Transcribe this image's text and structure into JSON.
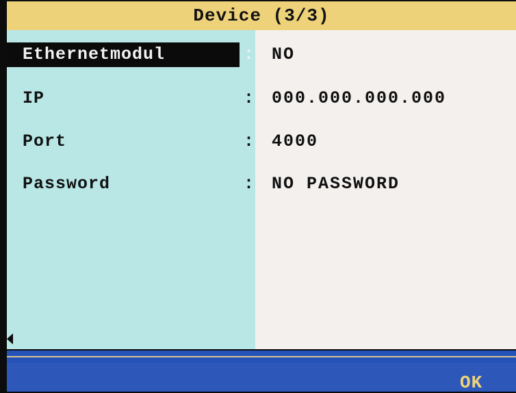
{
  "window": {
    "title": "Device (3/3)"
  },
  "settings": [
    {
      "label": "Ethernetmodul",
      "colon": ":",
      "value": "NO",
      "selected": true
    },
    {
      "label": "IP",
      "colon": ":",
      "value": "000.000.000.000",
      "selected": false
    },
    {
      "label": "Port",
      "colon": ":",
      "value": "4000",
      "selected": false
    },
    {
      "label": "Password",
      "colon": ":",
      "value": "NO PASSWORD",
      "selected": false
    }
  ],
  "footer": {
    "ok_label": "OK"
  },
  "colors": {
    "title_bg": "#eed27a",
    "label_panel_bg": "#b8e7e6",
    "value_panel_bg": "#f3f0ee",
    "footer_bg": "#2d58ba",
    "ok_text": "#eed27a"
  },
  "icons": {
    "left_arrow": "triangle-left-icon"
  }
}
